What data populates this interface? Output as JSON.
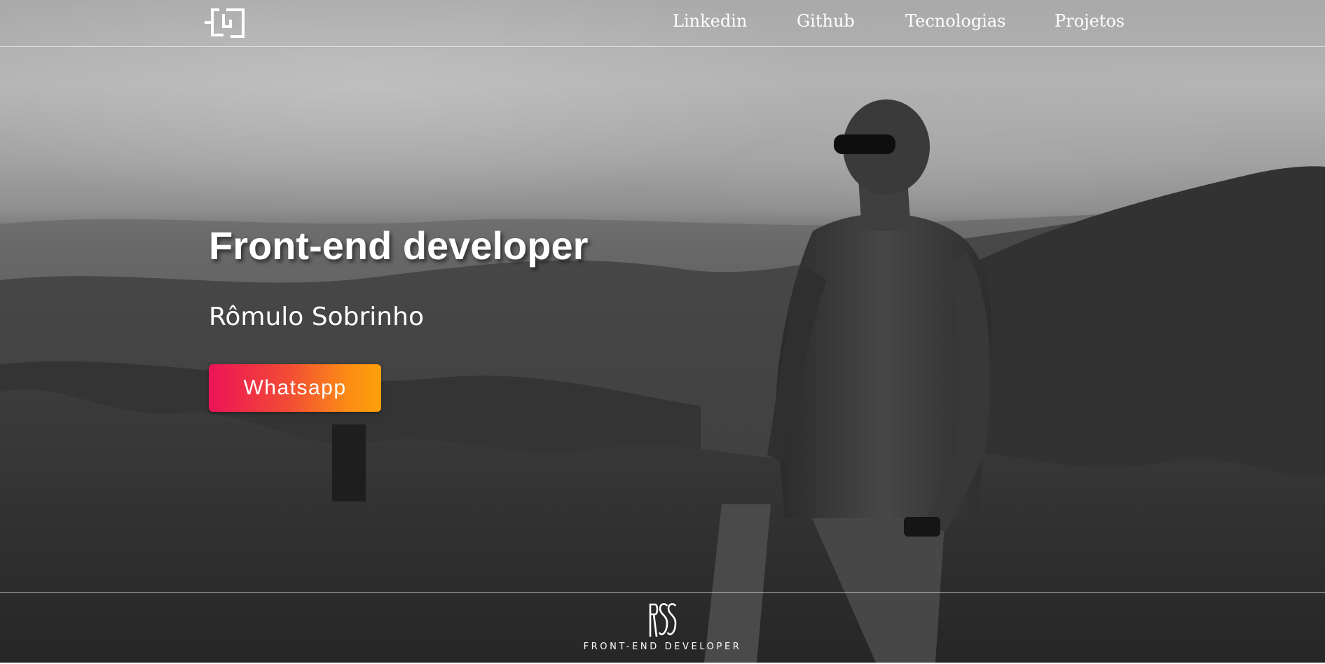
{
  "nav": {
    "logo_icon": "monogram-logo-icon",
    "links": [
      {
        "label": "Linkedin"
      },
      {
        "label": "Github"
      },
      {
        "label": "Tecnologias"
      },
      {
        "label": "Projetos"
      }
    ]
  },
  "hero": {
    "title": "Front-end developer",
    "name": "Rômulo Sobrinho",
    "cta_label": "Whatsapp",
    "cta_gradient": [
      "#ec1356",
      "#ffa10a"
    ]
  },
  "footer": {
    "mark_text": "RSS",
    "tagline": "FRONT-END DEVELOPER"
  }
}
